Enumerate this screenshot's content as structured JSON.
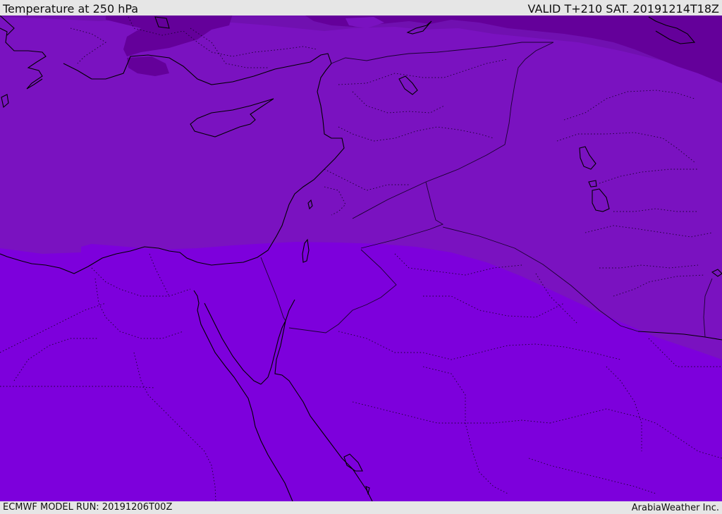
{
  "header": {
    "title": "Temperature at 250 hPa",
    "valid_time": "VALID T+210 SAT. 20191214T18Z"
  },
  "footer": {
    "model_run": "ECMWF MODEL RUN: 20191206T00Z",
    "credit": "ArabiaWeather Inc."
  },
  "colors": {
    "band_coldest": "#64009a",
    "band_cold": "#7010b0",
    "band_mid": "#7a12c0",
    "band_warm": "#7d00dc",
    "coastline": "#000000",
    "border": "#1a0030",
    "bar_background": "#e6e6e6"
  }
}
